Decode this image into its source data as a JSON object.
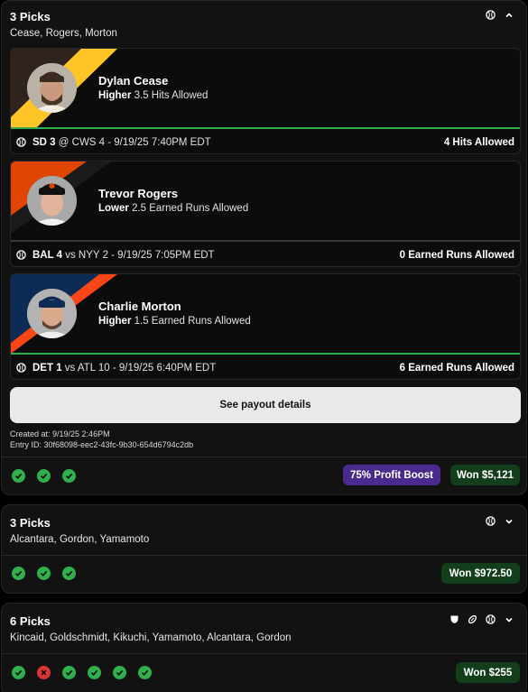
{
  "entries": [
    {
      "title": "3 Picks",
      "names": "Cease, Rogers, Morton",
      "icons": [
        "baseball-icon",
        "chevron-up-icon"
      ],
      "picks": [
        {
          "player": "Dylan Cease",
          "direction": "Higher",
          "line": "3.5 Hits Allowed",
          "game_team": "SD 3",
          "game_rest": "@ CWS 4 - 9/19/25 7:40PM EDT",
          "result": "4 Hits Allowed",
          "team_colors": [
            "#2f241d",
            "#ffc425"
          ]
        },
        {
          "player": "Trevor Rogers",
          "direction": "Lower",
          "line": "2.5 Earned Runs Allowed",
          "game_team": "BAL 4",
          "game_rest": "vs NYY 2 - 9/19/25 7:05PM EDT",
          "result": "0 Earned Runs Allowed",
          "team_colors": [
            "#df4601",
            "#000000"
          ]
        },
        {
          "player": "Charlie Morton",
          "direction": "Higher",
          "line": "1.5 Earned Runs Allowed",
          "game_team": "DET 1",
          "game_rest": "vs ATL 10 - 9/19/25 6:40PM EDT",
          "result": "6 Earned Runs Allowed",
          "team_colors": [
            "#0c2c56",
            "#fa4616"
          ]
        }
      ],
      "payout_button": "See payout details",
      "created_at": "Created at: 9/19/25 2:46PM",
      "entry_id": "Entry ID: 30f68098-eec2-43fc-9b30-654d6794c2db",
      "results": [
        "win",
        "win",
        "win"
      ],
      "boost": "75% Profit Boost",
      "won": "Won $5,121"
    },
    {
      "title": "3 Picks",
      "names": "Alcantara, Gordon, Yamamoto",
      "icons": [
        "baseball-icon",
        "chevron-down-icon"
      ],
      "results": [
        "win",
        "win",
        "win"
      ],
      "won": "Won $972.50"
    },
    {
      "title": "6 Picks",
      "names": "Kincaid, Goldschmidt, Kikuchi, Yamamoto, Alcantara, Gordon",
      "icons": [
        "hockey-shield-icon",
        "football-icon",
        "baseball-icon",
        "chevron-down-icon"
      ],
      "results": [
        "win",
        "loss",
        "win",
        "win",
        "win",
        "win"
      ],
      "won": "Won $255"
    }
  ],
  "colors": {
    "win": "#2fb04d",
    "loss": "#d93535",
    "boost_bg": "#4a2a8c",
    "won_bg": "#123e1c"
  }
}
